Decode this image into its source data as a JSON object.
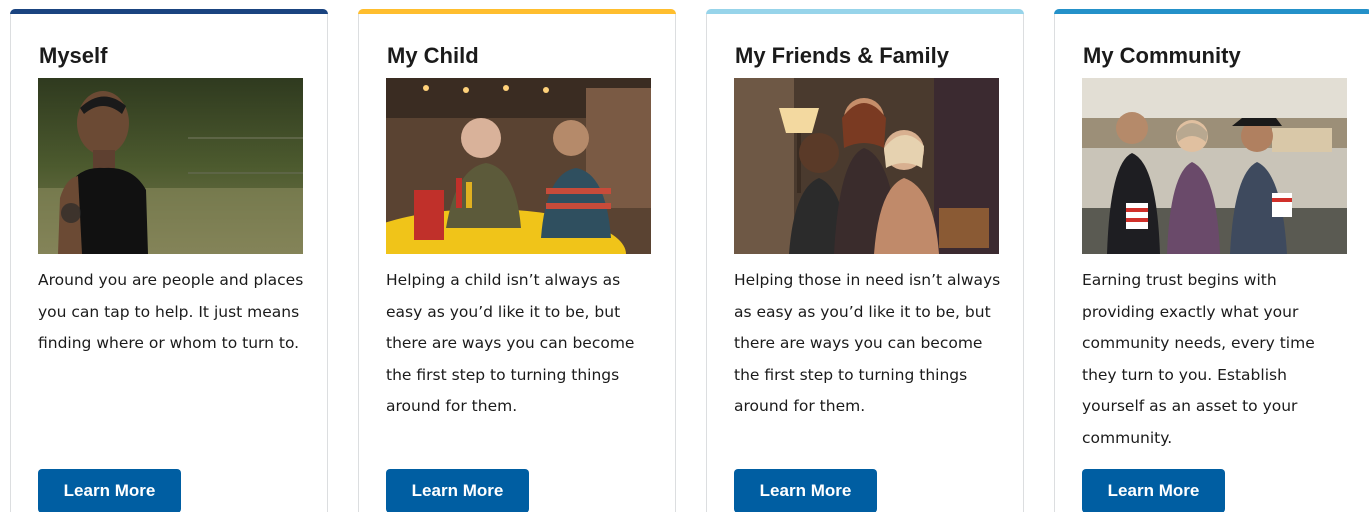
{
  "colors": {
    "button": "#005ea2",
    "accent_myself": "#1a4480",
    "accent_child": "#ffbe2e",
    "accent_friends": "#97d4ea",
    "accent_community": "#2491c9"
  },
  "cards": [
    {
      "title": "Myself",
      "image_alt": "Man with tattooed arm standing outdoors",
      "text": "Around you are people and places you can tap to help. It just means finding where or whom to turn to.",
      "button_label": "Learn More"
    },
    {
      "title": "My Child",
      "image_alt": "Father and son talking at a restaurant table",
      "text": "Helping a child isn’t always as easy as you’d like it to be, but there are ways you can become the first step to turning things around for them.",
      "button_label": "Learn More"
    },
    {
      "title": "My Friends & Family",
      "image_alt": "Three women hugging in a living room",
      "text": "Helping those in need isn’t always as easy as you’d like it to be, but there are ways you can become the first step to turning things around for them.",
      "button_label": "Learn More"
    },
    {
      "title": "My Community",
      "image_alt": "Community members seated together holding popcorn",
      "text": "Earning trust begins with providing exactly what your community needs, every time they turn to you. Establish yourself as an asset to your community.",
      "button_label": "Learn More"
    }
  ]
}
